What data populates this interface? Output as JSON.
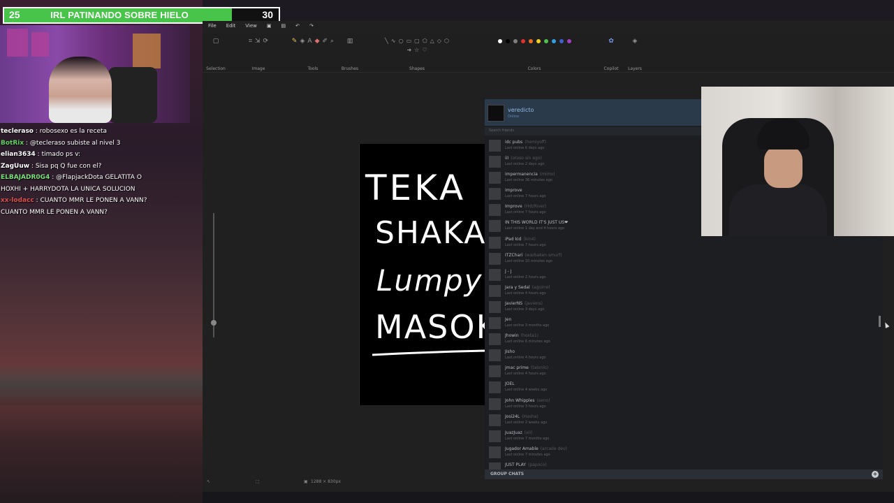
{
  "overlay": {
    "goal": {
      "label": "IRL PATINANDO SOBRE HIELO",
      "current": "25",
      "target": "30",
      "progress": 0.83
    }
  },
  "chat": [
    {
      "user": "tecleraso",
      "message": " : robosexo es la receta",
      "color": "#ffffff"
    },
    {
      "user": "BotRix",
      "message": " : @tecleraso subiste al nivel 3",
      "color": "#5fd35f"
    },
    {
      "user": "elian3634",
      "message": " : timado ps v:",
      "color": "#ffffff"
    },
    {
      "user": "ZagUuw",
      "message": " : Sisa pq Q fue con el?",
      "color": "#ffffff"
    },
    {
      "user": "ELBAJADR0G4",
      "message": " : @FlapjackDota GELATITA O",
      "color": "#79e07a"
    },
    {
      "user": "",
      "message": "HOXHI + HARRYDOTA LA UNICA SOLUCION",
      "color": "#ffffff"
    },
    {
      "user": "xx-lodacc",
      "message": " : CUANTO MMR LE PONEN A VANN?",
      "color": "#e05050"
    },
    {
      "user": "",
      "message": "CUANTO MMR LE PONEN A VANN?",
      "color": "#ffffff"
    }
  ],
  "paint": {
    "menu": [
      "File",
      "Edit",
      "View"
    ],
    "ribbon_groups": [
      "Selection",
      "Image",
      "Tools",
      "Brushes",
      "Shapes",
      "Colors",
      "Copilot",
      "Layers"
    ],
    "status": "1288 × 830px",
    "canvas_text": [
      "TEKA",
      "SHAKA",
      "Lumpy",
      "MASOK"
    ],
    "palette": [
      "#ffffff",
      "#000000",
      "#7f7f7f",
      "#e03030",
      "#f07020",
      "#f0d020",
      "#50c050",
      "#30a0e0",
      "#4060d0",
      "#a040c0"
    ]
  },
  "friends": {
    "username": "veredicto",
    "status": "Online",
    "search_placeholder": "Search friends",
    "list": [
      {
        "name": "idc pubs",
        "nick": "(hemiyoff)",
        "status": "Last online 6 days ago"
      },
      {
        "name": "iiI",
        "nick": "(otoso sin ego)",
        "status": "Last online 2 days ago"
      },
      {
        "name": "impermanencia",
        "nick": "(mimo)",
        "status": "Last online 36 minutes ago"
      },
      {
        "name": "improve",
        "nick": "",
        "status": "Last online 7 hours ago"
      },
      {
        "name": "Improve",
        "nick": "(HdzRiver)",
        "status": "Last online 7 hours ago"
      },
      {
        "name": "IN THIS WORLD IT'S JUST US❤",
        "nick": "",
        "status": "Last online 1 day and 4 hours ago"
      },
      {
        "name": "iPad kid",
        "nick": "(kin4)",
        "status": "Last online 7 hours ago"
      },
      {
        "name": "ITZChari",
        "nick": "(warbaken smurf)",
        "status": "Last online 10 minutes ago"
      },
      {
        "name": "J - J",
        "nick": "",
        "status": "Last online 2 hours ago"
      },
      {
        "name": "Jara y Sedal",
        "nick": "(aguirre)",
        "status": "Last online 4 hours ago"
      },
      {
        "name": "JavierNS",
        "nick": "(javiens)",
        "status": "Last online 3 days ago"
      },
      {
        "name": "Jen",
        "nick": "",
        "status": "Last online 3 months ago"
      },
      {
        "name": "Jhowin",
        "nick": "(hoxta1)",
        "status": "Last online 6 minutes ago"
      },
      {
        "name": "Jisho",
        "nick": "",
        "status": "Last online 4 hours ago"
      },
      {
        "name": "jmac prime",
        "nick": "(talonlo)",
        "status": "Last online 4 hours ago"
      },
      {
        "name": "JOEL",
        "nick": "",
        "status": "Last online 4 weeks ago"
      },
      {
        "name": "John Whipples",
        "nick": "(seno)",
        "status": "Last online 3 hours ago"
      },
      {
        "name": "Josi24L",
        "nick": "(Hasha)",
        "status": "Last online 2 weeks ago"
      },
      {
        "name": "JuazJuaz",
        "nick": "(eli)",
        "status": "Last online 7 months ago"
      },
      {
        "name": "Jugador Amable",
        "nick": "(arcade dev)",
        "status": "Last online 7 minutes ago"
      },
      {
        "name": "JUST PLAY",
        "nick": "(papoco)",
        "status": ""
      }
    ],
    "group_chats_label": "GROUP CHATS"
  }
}
